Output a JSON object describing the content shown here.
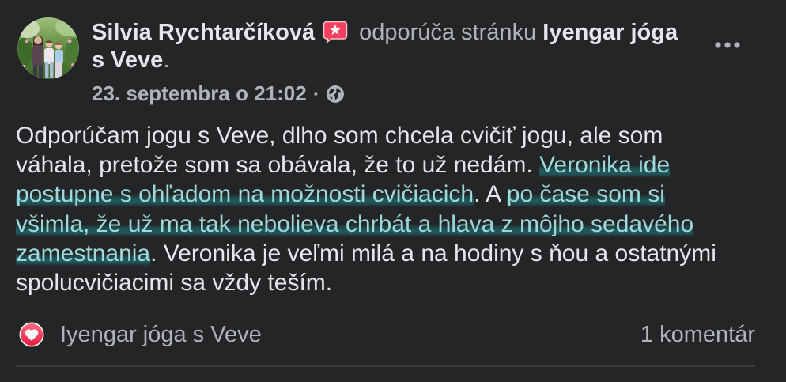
{
  "post": {
    "author": {
      "name": "Silvia Rychtarčíková"
    },
    "action_text": "odporúča stránku",
    "page_name": "Iyengar jóga s Veve",
    "after_page": ".",
    "timestamp": "23. septembra o 21:02",
    "separator": "·",
    "icons": {
      "avatar": "profile-photo-avatar",
      "recommendation": "recommendation-star-icon",
      "audience": "globe-icon",
      "more": "more-options-icon",
      "reaction": "love-reaction-icon"
    },
    "body": {
      "lines": [
        [
          {
            "text": "Odporúčam jogu s Veve, dlho som chcela cvičiť jogu, ale som",
            "highlight": false
          }
        ],
        [
          {
            "text": "váhala, pretože som sa obávala, že to už nedám. ",
            "highlight": false
          },
          {
            "text": "Veronika ide",
            "highlight": true
          }
        ],
        [
          {
            "text": "postupne s ohľadom na možnosti cvičiacich",
            "highlight": true
          },
          {
            "text": ". A ",
            "highlight": false
          },
          {
            "text": "po čase som si",
            "highlight": true
          }
        ],
        [
          {
            "text": "všimla, že už ma tak nebolieva chrbát a hlava z môjho sedavého",
            "highlight": true
          }
        ],
        [
          {
            "text": "zamestnania",
            "highlight": true
          },
          {
            "text": ". Veronika je veľmi milá a na hodiny s ňou a ostatnými",
            "highlight": false
          }
        ],
        [
          {
            "text": "spolucvičiacimi sa vždy teším.",
            "highlight": false
          }
        ]
      ]
    },
    "footer": {
      "reaction_text": "Iyengar jóga s Veve",
      "comments": "1 komentár"
    }
  },
  "colors": {
    "background": "#242526",
    "primary_text": "#e4e6eb",
    "secondary_text": "#b0b3b8",
    "highlight_text": "#9fd8db",
    "recommend_red": "#f3425f",
    "reaction_red": "#f33e58",
    "divider": "#3a3b3c"
  }
}
